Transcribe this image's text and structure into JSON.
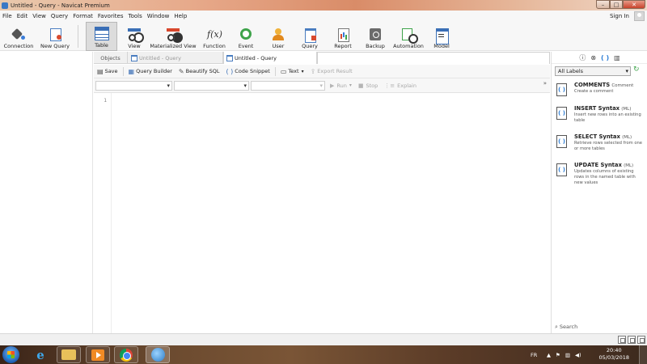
{
  "window": {
    "title": "Untitled - Query - Navicat Premium"
  },
  "menu": {
    "items": [
      "File",
      "Edit",
      "View",
      "Query",
      "Format",
      "Favorites",
      "Tools",
      "Window",
      "Help"
    ],
    "sign_in": "Sign In"
  },
  "toolbar": {
    "items": [
      {
        "label": "Connection",
        "icon": "connection-icon"
      },
      {
        "label": "New Query",
        "icon": "new-query-icon"
      },
      {
        "label": "Table",
        "icon": "table-icon",
        "active": true
      },
      {
        "label": "View",
        "icon": "view-icon"
      },
      {
        "label": "Materialized View",
        "icon": "materialized-view-icon"
      },
      {
        "label": "Function",
        "icon": "function-icon",
        "glyph": "f(x)"
      },
      {
        "label": "Event",
        "icon": "event-icon"
      },
      {
        "label": "User",
        "icon": "user-icon"
      },
      {
        "label": "Query",
        "icon": "query-icon"
      },
      {
        "label": "Report",
        "icon": "report-icon"
      },
      {
        "label": "Backup",
        "icon": "backup-icon"
      },
      {
        "label": "Automation",
        "icon": "automation-icon"
      },
      {
        "label": "Model",
        "icon": "model-icon"
      }
    ]
  },
  "tabs": {
    "objects": "Objects",
    "items": [
      {
        "label": "Untitled - Query",
        "active": false
      },
      {
        "label": "Untitled - Query",
        "active": true
      }
    ]
  },
  "query_toolbar": {
    "save": "Save",
    "query_builder": "Query Builder",
    "beautify": "Beautify SQL",
    "snippet": "Code Snippet",
    "text": "Text",
    "export": "Export Result",
    "run": "Run",
    "stop": "Stop",
    "explain": "Explain"
  },
  "editor": {
    "line_number": "1"
  },
  "right_pane": {
    "filter_value": "All Labels",
    "snippets": [
      {
        "title": "COMMENTS",
        "sub": "Comment",
        "desc": "Create a comment"
      },
      {
        "title": "INSERT Syntax",
        "sub": "(ML)",
        "desc": "Insert new rows into an existing table"
      },
      {
        "title": "SELECT Syntax",
        "sub": "(ML)",
        "desc": "Retrieve rows selected from one or more tables"
      },
      {
        "title": "UPDATE Syntax",
        "sub": "(ML)",
        "desc": "Updates columns of existing rows in the named table with new values"
      }
    ],
    "search": "Search"
  },
  "taskbar": {
    "language": "FR",
    "time": "20:40",
    "date": "05/03/2018"
  },
  "colors": {
    "accent": "#2f7fd6",
    "active_tab_bg": "#ffffff",
    "taskbar": "#5a3b27"
  }
}
